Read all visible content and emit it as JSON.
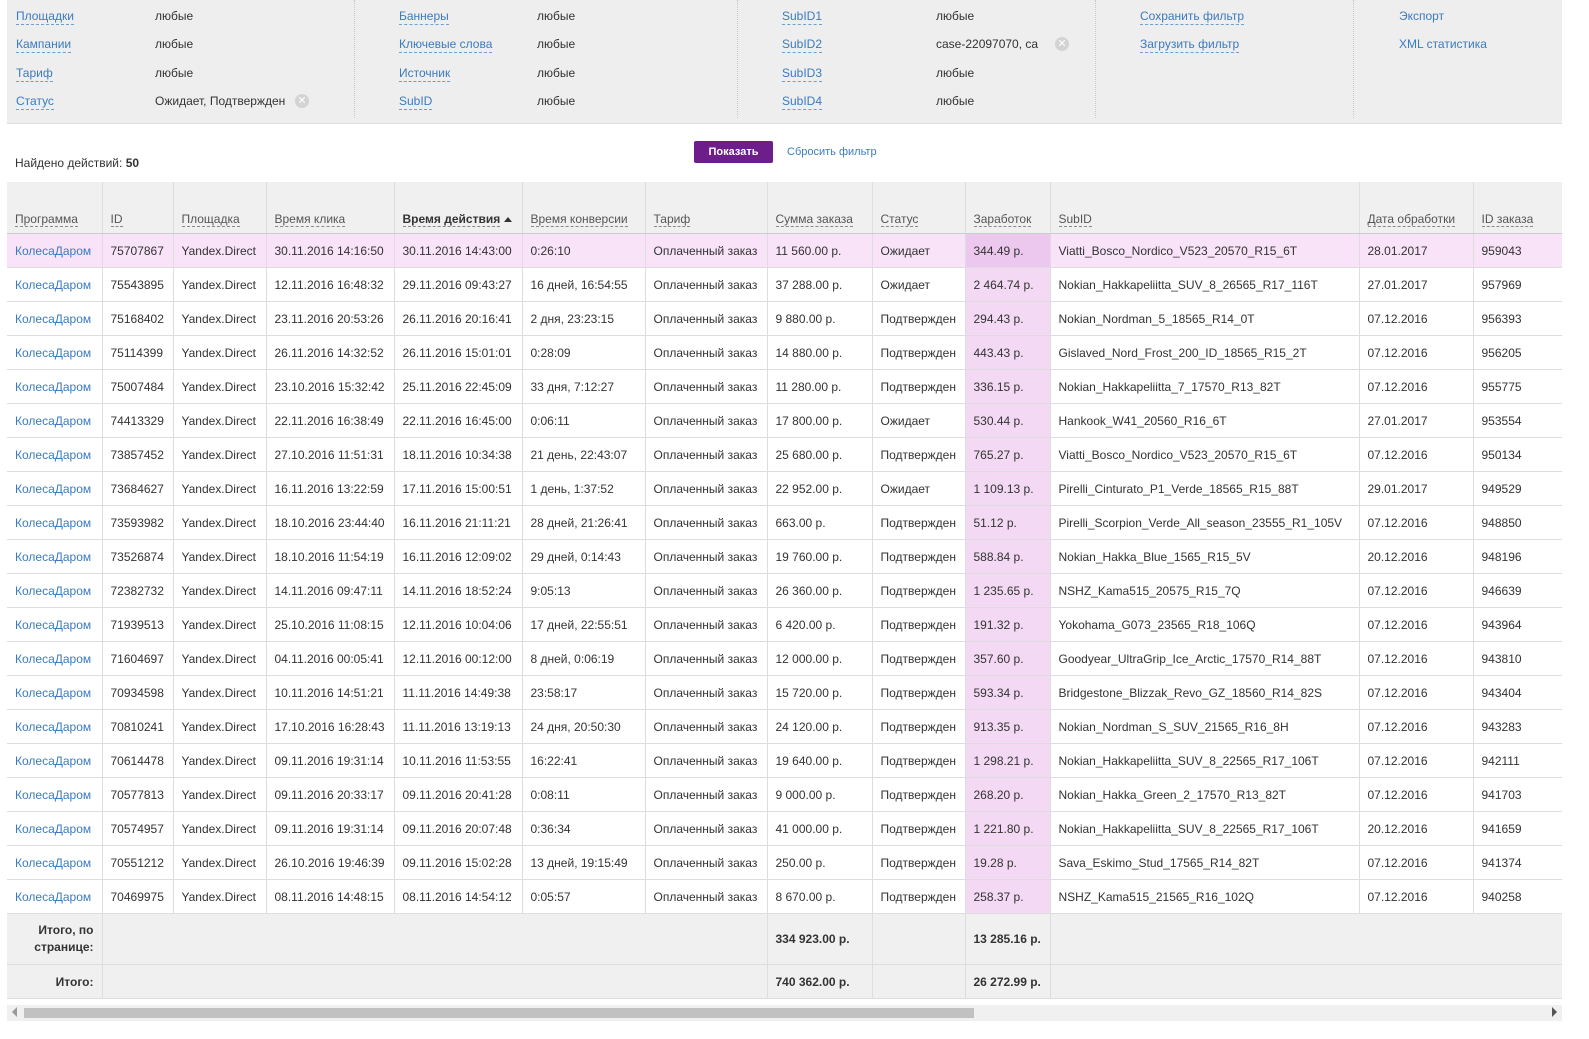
{
  "filters": {
    "col1": [
      {
        "label": "Площадки",
        "value": "любые"
      },
      {
        "label": "Кампании",
        "value": "любые"
      },
      {
        "label": "Тариф",
        "value": "любые"
      },
      {
        "label": "Статус",
        "value": "Ожидает, Подтвержден"
      }
    ],
    "col2": [
      {
        "label": "Баннеры",
        "value": "любые"
      },
      {
        "label": "Ключевые слова",
        "value": "любые"
      },
      {
        "label": "Источник",
        "value": "любые"
      },
      {
        "label": "SubID",
        "value": "любые"
      }
    ],
    "col3": [
      {
        "label": "SubID1",
        "value": "любые"
      },
      {
        "label": "SubID2",
        "value": "case-22097070, ca"
      },
      {
        "label": "SubID3",
        "value": "любые"
      },
      {
        "label": "SubID4",
        "value": "любые"
      }
    ],
    "save_filter": "Сохранить фильтр",
    "load_filter": "Загрузить фильтр",
    "export": "Экспорт",
    "xml_stats": "XML статистика"
  },
  "actions": {
    "found_label": "Найдено действий:",
    "found_count": "50",
    "show_button": "Показать",
    "reset_filter": "Сбросить фильтр"
  },
  "table": {
    "columns": [
      "Программа",
      "ID",
      "Площадка",
      "Время клика",
      "Время действия",
      "Время конверсии",
      "Тариф",
      "Сумма заказа",
      "Статус",
      "Заработок",
      "SubID",
      "Дата обработки",
      "ID заказа"
    ],
    "rows": [
      [
        "КолесаДаром",
        "75707867",
        "Yandex.Direct",
        "30.11.2016 14:16:50",
        "30.11.2016 14:43:00",
        "0:26:10",
        "Оплаченный заказ",
        "11 560.00 р.",
        "Ожидает",
        "344.49 р.",
        "Viatti_Bosco_Nordico_V523_20570_R15_6T",
        "28.01.2017",
        "959043"
      ],
      [
        "КолесаДаром",
        "75543895",
        "Yandex.Direct",
        "12.11.2016 16:48:32",
        "29.11.2016 09:43:27",
        "16 дней, 16:54:55",
        "Оплаченный заказ",
        "37 288.00 р.",
        "Ожидает",
        "2 464.74 р.",
        "Nokian_Hakkapeliitta_SUV_8_26565_R17_116T",
        "27.01.2017",
        "957969"
      ],
      [
        "КолесаДаром",
        "75168402",
        "Yandex.Direct",
        "23.11.2016 20:53:26",
        "26.11.2016 20:16:41",
        "2 дня, 23:23:15",
        "Оплаченный заказ",
        "9 880.00 р.",
        "Подтвержден",
        "294.43 р.",
        "Nokian_Nordman_5_18565_R14_0T",
        "07.12.2016",
        "956393"
      ],
      [
        "КолесаДаром",
        "75114399",
        "Yandex.Direct",
        "26.11.2016 14:32:52",
        "26.11.2016 15:01:01",
        "0:28:09",
        "Оплаченный заказ",
        "14 880.00 р.",
        "Подтвержден",
        "443.43 р.",
        "Gislaved_Nord_Frost_200_ID_18565_R15_2T",
        "07.12.2016",
        "956205"
      ],
      [
        "КолесаДаром",
        "75007484",
        "Yandex.Direct",
        "23.10.2016 15:32:42",
        "25.11.2016 22:45:09",
        "33 дня, 7:12:27",
        "Оплаченный заказ",
        "11 280.00 р.",
        "Подтвержден",
        "336.15 р.",
        "Nokian_Hakkapeliitta_7_17570_R13_82T",
        "07.12.2016",
        "955775"
      ],
      [
        "КолесаДаром",
        "74413329",
        "Yandex.Direct",
        "22.11.2016 16:38:49",
        "22.11.2016 16:45:00",
        "0:06:11",
        "Оплаченный заказ",
        "17 800.00 р.",
        "Ожидает",
        "530.44 р.",
        "Hankook_W41_20560_R16_6T",
        "27.01.2017",
        "953554"
      ],
      [
        "КолесаДаром",
        "73857452",
        "Yandex.Direct",
        "27.10.2016 11:51:31",
        "18.11.2016 10:34:38",
        "21 день, 22:43:07",
        "Оплаченный заказ",
        "25 680.00 р.",
        "Подтвержден",
        "765.27 р.",
        "Viatti_Bosco_Nordico_V523_20570_R15_6T",
        "07.12.2016",
        "950134"
      ],
      [
        "КолесаДаром",
        "73684627",
        "Yandex.Direct",
        "16.11.2016 13:22:59",
        "17.11.2016 15:00:51",
        "1 день, 1:37:52",
        "Оплаченный заказ",
        "22 952.00 р.",
        "Ожидает",
        "1 109.13 р.",
        "Pirelli_Cinturato_P1_Verde_18565_R15_88T",
        "29.01.2017",
        "949529"
      ],
      [
        "КолесаДаром",
        "73593982",
        "Yandex.Direct",
        "18.10.2016 23:44:40",
        "16.11.2016 21:11:21",
        "28 дней, 21:26:41",
        "Оплаченный заказ",
        "663.00 р.",
        "Подтвержден",
        "51.12 р.",
        "Pirelli_Scorpion_Verde_All_season_23555_R1_105V",
        "07.12.2016",
        "948850"
      ],
      [
        "КолесаДаром",
        "73526874",
        "Yandex.Direct",
        "18.10.2016 11:54:19",
        "16.11.2016 12:09:02",
        "29 дней, 0:14:43",
        "Оплаченный заказ",
        "19 760.00 р.",
        "Подтвержден",
        "588.84 р.",
        "Nokian_Hakka_Blue_1565_R15_5V",
        "20.12.2016",
        "948196"
      ],
      [
        "КолесаДаром",
        "72382732",
        "Yandex.Direct",
        "14.11.2016 09:47:11",
        "14.11.2016 18:52:24",
        "9:05:13",
        "Оплаченный заказ",
        "26 360.00 р.",
        "Подтвержден",
        "1 235.65 р.",
        "NSHZ_Kama515_20575_R15_7Q",
        "07.12.2016",
        "946639"
      ],
      [
        "КолесаДаром",
        "71939513",
        "Yandex.Direct",
        "25.10.2016 11:08:15",
        "12.11.2016 10:04:06",
        "17 дней, 22:55:51",
        "Оплаченный заказ",
        "6 420.00 р.",
        "Подтвержден",
        "191.32 р.",
        "Yokohama_G073_23565_R18_106Q",
        "07.12.2016",
        "943964"
      ],
      [
        "КолесаДаром",
        "71604697",
        "Yandex.Direct",
        "04.11.2016 00:05:41",
        "12.11.2016 00:12:00",
        "8 дней, 0:06:19",
        "Оплаченный заказ",
        "12 000.00 р.",
        "Подтвержден",
        "357.60 р.",
        "Goodyear_UltraGrip_Ice_Arctic_17570_R14_88T",
        "07.12.2016",
        "943810"
      ],
      [
        "КолесаДаром",
        "70934598",
        "Yandex.Direct",
        "10.11.2016 14:51:21",
        "11.11.2016 14:49:38",
        "23:58:17",
        "Оплаченный заказ",
        "15 720.00 р.",
        "Подтвержден",
        "593.34 р.",
        "Bridgestone_Blizzak_Revo_GZ_18560_R14_82S",
        "07.12.2016",
        "943404"
      ],
      [
        "КолесаДаром",
        "70810241",
        "Yandex.Direct",
        "17.10.2016 16:28:43",
        "11.11.2016 13:19:13",
        "24 дня, 20:50:30",
        "Оплаченный заказ",
        "24 120.00 р.",
        "Подтвержден",
        "913.35 р.",
        "Nokian_Nordman_S_SUV_21565_R16_8H",
        "07.12.2016",
        "943283"
      ],
      [
        "КолесаДаром",
        "70614478",
        "Yandex.Direct",
        "09.11.2016 19:31:14",
        "10.11.2016 11:53:55",
        "16:22:41",
        "Оплаченный заказ",
        "19 640.00 р.",
        "Подтвержден",
        "1 298.21 р.",
        "Nokian_Hakkapeliitta_SUV_8_22565_R17_106T",
        "07.12.2016",
        "942111"
      ],
      [
        "КолесаДаром",
        "70577813",
        "Yandex.Direct",
        "09.11.2016 20:33:17",
        "09.11.2016 20:41:28",
        "0:08:11",
        "Оплаченный заказ",
        "9 000.00 р.",
        "Подтвержден",
        "268.20 р.",
        "Nokian_Hakka_Green_2_17570_R13_82T",
        "07.12.2016",
        "941703"
      ],
      [
        "КолесаДаром",
        "70574957",
        "Yandex.Direct",
        "09.11.2016 19:31:14",
        "09.11.2016 20:07:48",
        "0:36:34",
        "Оплаченный заказ",
        "41 000.00 р.",
        "Подтвержден",
        "1 221.80 р.",
        "Nokian_Hakkapeliitta_SUV_8_22565_R17_106T",
        "20.12.2016",
        "941659"
      ],
      [
        "КолесаДаром",
        "70551212",
        "Yandex.Direct",
        "26.10.2016 19:46:39",
        "09.11.2016 15:02:28",
        "13 дней, 19:15:49",
        "Оплаченный заказ",
        "250.00 р.",
        "Подтвержден",
        "19.28 р.",
        "Sava_Eskimo_Stud_17565_R14_82T",
        "07.12.2016",
        "941374"
      ],
      [
        "КолесаДаром",
        "70469975",
        "Yandex.Direct",
        "08.11.2016 14:48:15",
        "08.11.2016 14:54:12",
        "0:05:57",
        "Оплаченный заказ",
        "8 670.00 р.",
        "Подтвержден",
        "258.37 р.",
        "NSHZ_Kama515_21565_R16_102Q",
        "07.12.2016",
        "940258"
      ]
    ],
    "totals_page": {
      "label": "Итого, по странице:",
      "sum": "334 923.00 р.",
      "earn": "13 285.16 р."
    },
    "totals_all": {
      "label": "Итого:",
      "sum": "740 362.00 р.",
      "earn": "26 272.99 р."
    }
  },
  "colors": {
    "accent": "#6d1e8a",
    "link": "#3b7bbf",
    "highlight_row": "#f8e3f8",
    "earnings_col": "#f3d9f3"
  }
}
